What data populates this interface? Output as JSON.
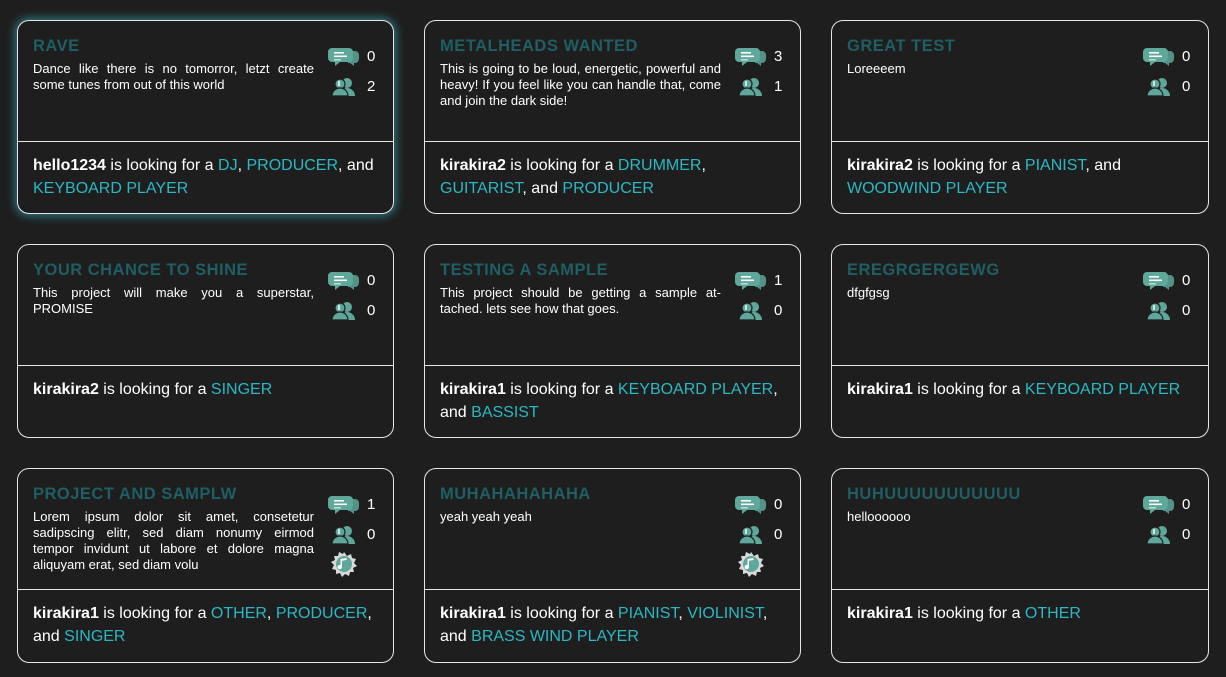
{
  "connector": "is looking for a",
  "colors": {
    "accent": "#2bb8c4",
    "title": "#1f5e63",
    "icon": "#5ea79a",
    "background": "#1e1e1e"
  },
  "projects": [
    {
      "title": "RAVE",
      "description": "Dance like there is no tomorror, letzt create some tunes from out of this world",
      "comments": "0",
      "members": "2",
      "has_sample": false,
      "owner": "hello1234",
      "roles": [
        "DJ",
        "PRODUCER",
        "KEYBOARD PLAYER"
      ]
    },
    {
      "title": "METALHEADS WANTED",
      "description": "This is going to be loud, energetic, powerful and heavy! If you feel like you can handle that, come and join the dark side!",
      "comments": "3",
      "members": "1",
      "has_sample": false,
      "owner": "kirakira2",
      "roles": [
        "DRUMMER",
        "GUITARIST",
        "PRODUCER"
      ]
    },
    {
      "title": "GREAT TEST",
      "description": "Loreeeem",
      "comments": "0",
      "members": "0",
      "has_sample": false,
      "owner": "kirakira2",
      "roles": [
        "PIANIST",
        "WOODWIND PLAYER"
      ]
    },
    {
      "title": "YOUR CHANCE TO SHINE",
      "description": "This project will make you a superstar, PROMISE",
      "comments": "0",
      "members": "0",
      "has_sample": false,
      "owner": "kirakira2",
      "roles": [
        "SINGER"
      ]
    },
    {
      "title": "TESTING A SAMPLE",
      "description": "This project should be getting a sample at-tached. lets see how that goes.",
      "comments": "1",
      "members": "0",
      "has_sample": false,
      "owner": "kirakira1",
      "roles": [
        "KEYBOARD PLAYER",
        "BASSIST"
      ]
    },
    {
      "title": "EREGRGERGEWG",
      "description": "dfgfgsg",
      "comments": "0",
      "members": "0",
      "has_sample": false,
      "owner": "kirakira1",
      "roles": [
        "KEYBOARD PLAYER"
      ]
    },
    {
      "title": "PROJECT AND SAMPLW",
      "description": "Lorem ipsum dolor sit amet, consetetur sadipscing elitr, sed diam nonumy eirmod tempor invidunt ut labore et dolore magna aliquyam erat, sed diam volu",
      "comments": "1",
      "members": "0",
      "has_sample": true,
      "owner": "kirakira1",
      "roles": [
        "OTHER",
        "PRODUCER",
        "SINGER"
      ]
    },
    {
      "title": "MUHAHAHAHAHA",
      "description": "yeah yeah yeah",
      "comments": "0",
      "members": "0",
      "has_sample": true,
      "owner": "kirakira1",
      "roles": [
        "PIANIST",
        "VIOLINIST",
        "BRASS WIND PLAYER"
      ]
    },
    {
      "title": "HUHUUUUUUUUUUU",
      "description": "helloooooo",
      "comments": "0",
      "members": "0",
      "has_sample": false,
      "owner": "kirakira1",
      "roles": [
        "OTHER"
      ]
    }
  ]
}
